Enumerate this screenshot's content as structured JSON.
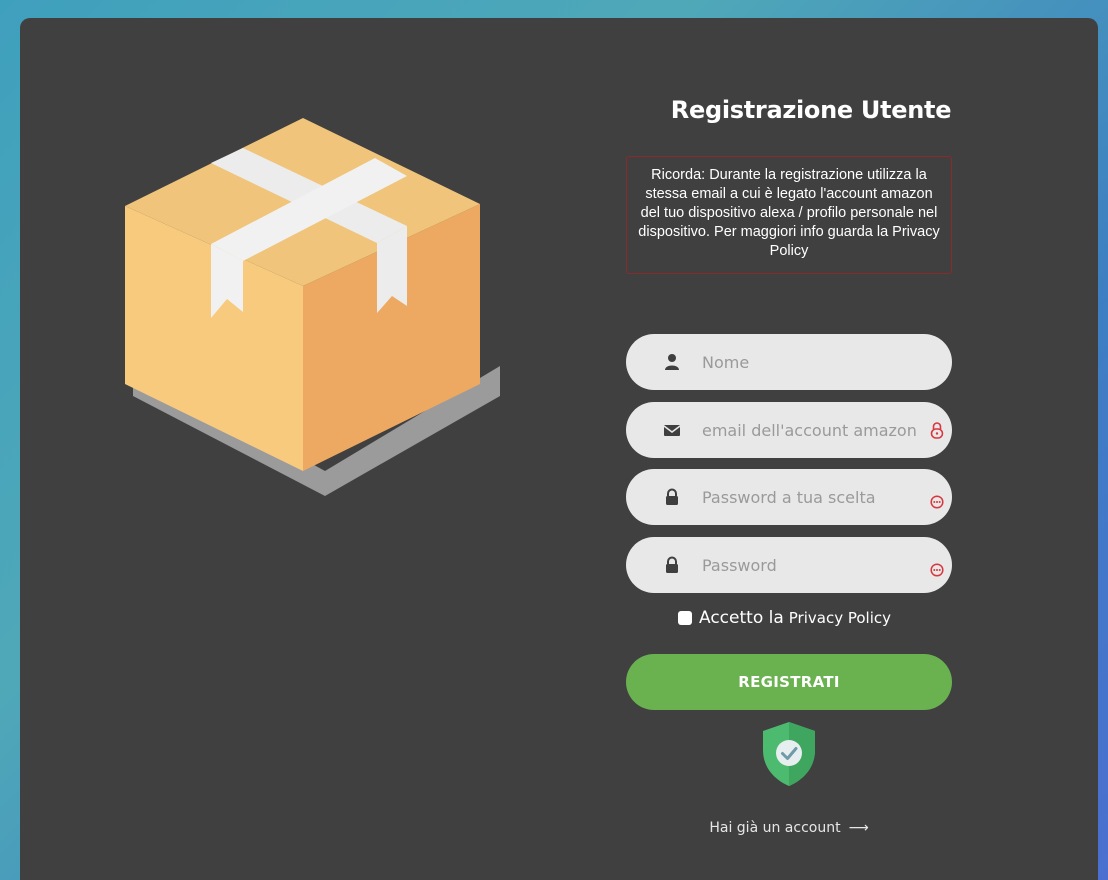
{
  "form": {
    "title": "Registrazione Utente",
    "notice": "Ricorda: Durante la registrazione utilizza la stessa email a cui è legato l'account amazon del tuo dispositivo alexa / profilo personale nel dispositivo. Per maggiori info guarda la Privacy Policy",
    "fields": [
      {
        "placeholder": "Nome",
        "value": "",
        "icon": "user-icon"
      },
      {
        "placeholder": "email dell'account amazon",
        "value": "",
        "icon": "envelope-icon",
        "trailing_icon": "lock-icon"
      },
      {
        "placeholder": "Password a tua scelta",
        "value": "",
        "icon": "lock-icon",
        "trailing_icon": "password-dots-icon"
      },
      {
        "placeholder": "Password",
        "value": "",
        "icon": "lock-icon",
        "trailing_icon": "password-dots-icon"
      }
    ],
    "consent_label": "Accetto la",
    "consent_link": "Privacy Policy",
    "submit_label": "REGISTRATI",
    "login_link": "Hai già un account",
    "login_arrow": "⟶"
  },
  "colors": {
    "card_bg": "#404040",
    "field_bg": "#e8e8e8",
    "submit_bg": "#6ab150",
    "notice_border": "#8a2a2a",
    "accent_red": "#d9363e",
    "shield_green": "#4dbb6f"
  }
}
